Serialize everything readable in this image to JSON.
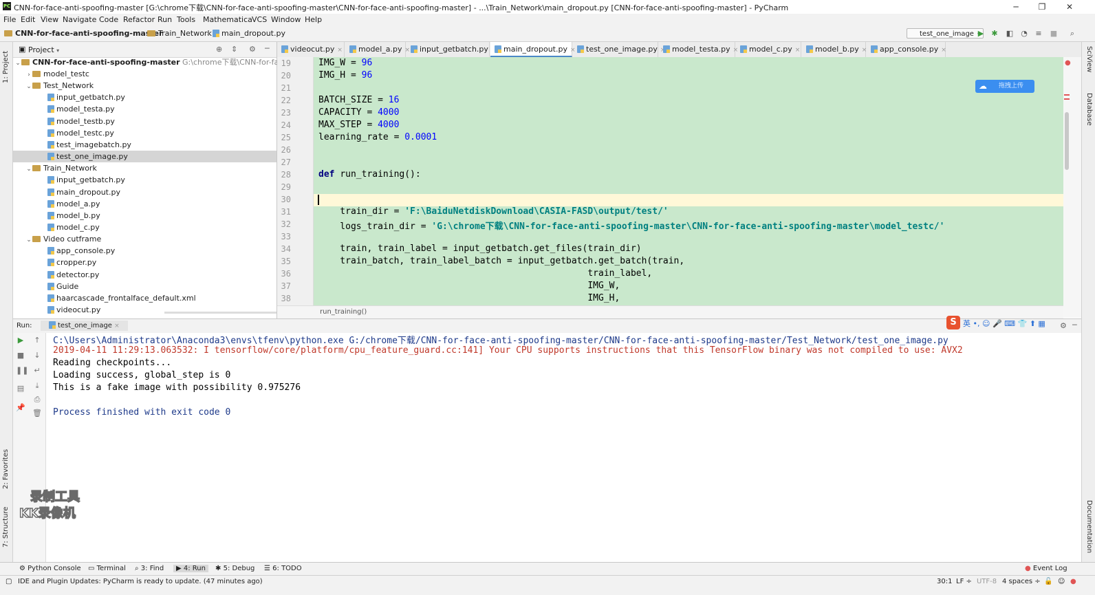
{
  "window": {
    "title": "CNN-for-face-anti-spoofing-master [G:\\chrome下载\\CNN-for-face-anti-spoofing-master\\CNN-for-face-anti-spoofing-master] - ...\\Train_Network\\main_dropout.py [CNN-for-face-anti-spoofing-master] - PyCharm",
    "app_icon": "PC"
  },
  "menu": [
    "File",
    "Edit",
    "View",
    "Navigate",
    "Code",
    "Refactor",
    "Run",
    "Tools",
    "Mathematica",
    "VCS",
    "Window",
    "Help"
  ],
  "breadcrumb": [
    "CNN-for-face-anti-spoofing-master",
    "Train_Network",
    "main_dropout.py"
  ],
  "run_config": "test_one_image",
  "project_panel": {
    "title": "Project",
    "root": "CNN-for-face-anti-spoofing-master",
    "root_path": "G:\\chrome下载\\CNN-for-face-anti-s",
    "items": [
      {
        "label": "model_testc",
        "type": "folder",
        "arrow": "›"
      },
      {
        "label": "Test_Network",
        "type": "folder",
        "arrow": "⌄"
      },
      {
        "label": "input_getbatch.py",
        "type": "file"
      },
      {
        "label": "model_testa.py",
        "type": "file"
      },
      {
        "label": "model_testb.py",
        "type": "file"
      },
      {
        "label": "model_testc.py",
        "type": "file"
      },
      {
        "label": "test_imagebatch.py",
        "type": "file"
      },
      {
        "label": "test_one_image.py",
        "type": "file",
        "selected": true
      },
      {
        "label": "Train_Network",
        "type": "folder",
        "arrow": "⌄"
      },
      {
        "label": "input_getbatch.py",
        "type": "file"
      },
      {
        "label": "main_dropout.py",
        "type": "file"
      },
      {
        "label": "model_a.py",
        "type": "file"
      },
      {
        "label": "model_b.py",
        "type": "file"
      },
      {
        "label": "model_c.py",
        "type": "file"
      },
      {
        "label": "Video cutframe",
        "type": "folder",
        "arrow": "⌄"
      },
      {
        "label": "app_console.py",
        "type": "file"
      },
      {
        "label": "cropper.py",
        "type": "file"
      },
      {
        "label": "detector.py",
        "type": "file"
      },
      {
        "label": "Guide",
        "type": "file"
      },
      {
        "label": "haarcascade_frontalface_default.xml",
        "type": "file"
      },
      {
        "label": "videocut.py",
        "type": "file"
      }
    ]
  },
  "tabs": [
    {
      "label": "videocut.py"
    },
    {
      "label": "model_a.py"
    },
    {
      "label": "input_getbatch.py"
    },
    {
      "label": "main_dropout.py",
      "active": true
    },
    {
      "label": "test_one_image.py"
    },
    {
      "label": "model_testa.py"
    },
    {
      "label": "model_c.py"
    },
    {
      "label": "model_b.py"
    },
    {
      "label": "app_console.py"
    }
  ],
  "editor": {
    "lines": [
      {
        "n": "19",
        "code": [
          [
            "",
            "IMG_W = "
          ],
          [
            "num",
            "96"
          ]
        ]
      },
      {
        "n": "20",
        "code": [
          [
            "",
            "IMG_H = "
          ],
          [
            "num",
            "96"
          ]
        ]
      },
      {
        "n": "21",
        "code": []
      },
      {
        "n": "22",
        "code": [
          [
            "",
            "BATCH_SIZE = "
          ],
          [
            "num",
            "16"
          ]
        ]
      },
      {
        "n": "23",
        "code": [
          [
            "",
            "CAPACITY = "
          ],
          [
            "num",
            "4000"
          ]
        ]
      },
      {
        "n": "24",
        "code": [
          [
            "",
            "MAX_STEP = "
          ],
          [
            "num",
            "4000"
          ]
        ]
      },
      {
        "n": "25",
        "code": [
          [
            "",
            "learning_rate = "
          ],
          [
            "num",
            "0.0001"
          ]
        ]
      },
      {
        "n": "26",
        "code": []
      },
      {
        "n": "27",
        "code": []
      },
      {
        "n": "28",
        "code": [
          [
            "kw",
            "def "
          ],
          [
            "",
            "run_training():"
          ]
        ]
      },
      {
        "n": "29",
        "code": []
      },
      {
        "n": "30",
        "code": [],
        "current": true
      },
      {
        "n": "31",
        "code": [
          [
            "",
            "    train_dir = "
          ],
          [
            "str",
            "'F:\\BaiduNetdiskDownload\\CASIA-FASD\\output/test/'"
          ]
        ]
      },
      {
        "n": "32",
        "code": [
          [
            "",
            "    logs_train_dir = "
          ],
          [
            "str",
            "'G:\\chrome下载\\CNN-for-face-anti-spoofing-master\\CNN-for-face-anti-spoofing-master\\model_testc/'"
          ]
        ]
      },
      {
        "n": "33",
        "code": []
      },
      {
        "n": "34",
        "code": [
          [
            "",
            "    train, train_label = input_getbatch.get_files(train_dir)"
          ]
        ]
      },
      {
        "n": "35",
        "code": [
          [
            "",
            "    train_batch, train_label_batch = input_getbatch.get_batch(train,"
          ]
        ]
      },
      {
        "n": "36",
        "code": [
          [
            "",
            "                                                  train_label,"
          ]
        ]
      },
      {
        "n": "37",
        "code": [
          [
            "",
            "                                                  IMG_W,"
          ]
        ]
      },
      {
        "n": "38",
        "code": [
          [
            "",
            "                                                  IMG_H,"
          ]
        ]
      }
    ],
    "breadcrumb": "run_training()"
  },
  "upload_badge": "拖拽上传",
  "ime_bar": "英 •, ☺ 🎤 ⌨ 👕 ⬆ ▦",
  "run_panel": {
    "label": "Run:",
    "tab": "test_one_image",
    "console": [
      {
        "text": "C:\\Users\\Administrator\\Anaconda3\\envs\\tfenv\\python.exe G:/chrome下载/CNN-for-face-anti-spoofing-master/CNN-for-face-anti-spoofing-master/Test_Network/test_one_image.py",
        "color": "#1e3a8a"
      },
      {
        "text": "2019-04-11 11:29:13.063532: I tensorflow/core/platform/cpu_feature_guard.cc:141] Your CPU supports instructions that this TensorFlow binary was not compiled to use: AVX2",
        "color": "#c0392b"
      },
      {
        "text": "Reading checkpoints...",
        "color": "#000000"
      },
      {
        "text": "Loading success, global_step is 0",
        "color": "#000000"
      },
      {
        "text": "This is a fake image with possibility 0.975276",
        "color": "#000000"
      },
      {
        "text": "",
        "color": "#000000"
      },
      {
        "text": "Process finished with exit code 0",
        "color": "#1e3a8a"
      }
    ]
  },
  "left_stripe": [
    "1: Project",
    "2: Favorites",
    "7: Structure"
  ],
  "right_stripe": [
    "SciView",
    "Database",
    "Documentation"
  ],
  "bottom_tabs": [
    "Python Console",
    "Terminal",
    "3: Find",
    "4: Run",
    "5: Debug",
    "6: TODO"
  ],
  "event_log": "Event Log",
  "status": {
    "message": "IDE and Plugin Updates: PyCharm is ready to update. (47 minutes ago)",
    "position": "30:1",
    "line_sep": "LF ÷",
    "encoding": "UTF-8",
    "indent": "4 spaces ÷"
  },
  "watermark": [
    "录制工具",
    "KK录像机"
  ],
  "colors": {
    "editor_bg": "#c9e8cc",
    "current_line": "#fff8d8",
    "accent": "#4a88c7"
  }
}
